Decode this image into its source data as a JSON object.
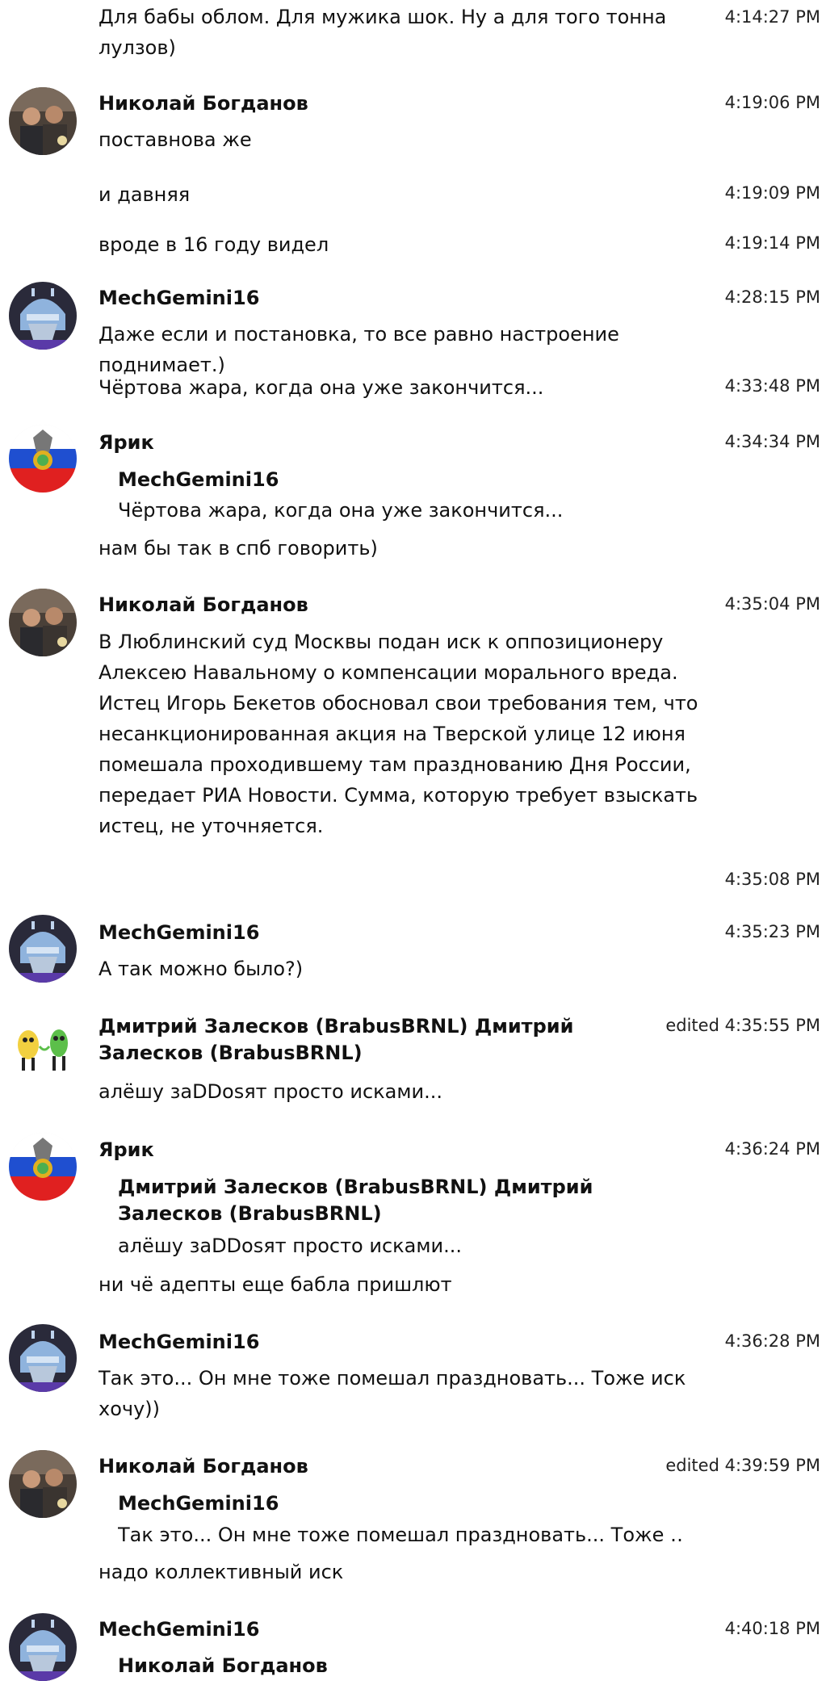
{
  "messages": {
    "m0": {
      "text": "Для бабы облом. Для мужика шок. Ну а для того тонна лулзов)",
      "time": "4:14:27 PM"
    },
    "g1": {
      "author": "Николай Богданов",
      "time": "4:19:06 PM",
      "text": "поставнова же"
    },
    "m2": {
      "text": "и давняя",
      "time": "4:19:09 PM"
    },
    "m3": {
      "text": "вроде в 16 году видел",
      "time": "4:19:14 PM"
    },
    "g4": {
      "author": "MechGemini16",
      "time": "4:28:15 PM",
      "text": "Даже если и постановка, то все равно настроение поднимает.)"
    },
    "m5": {
      "text": "Чёртова жара, когда она уже закончится...",
      "time": "4:33:48 PM"
    },
    "g6": {
      "author": "Ярик",
      "time": "4:34:34 PM",
      "quote_author": "MechGemini16",
      "quote_text": "Чёртова жара, когда она уже закончится...",
      "text": "нам бы так в спб говорить)"
    },
    "g7": {
      "author": "Николай Богданов",
      "time": "4:35:04 PM",
      "text": "В Люблинский суд Москвы подан иск к оппозиционеру Алексею Навальному о компенсации морального вреда. Истец Игорь Бекетов обосновал свои требования тем, что несанкционированная акция на Тверской улице 12 июня помешала проходившему там празднованию Дня России, передает РИА Новости. Сумма, которую требует взыскать истец, не уточняется."
    },
    "m8": {
      "time": "4:35:08 PM"
    },
    "g9": {
      "author": "MechGemini16",
      "time": "4:35:23 PM",
      "text": "А так можно было?)"
    },
    "g10": {
      "author": "Дмитрий Залесков (BrabusBRNL) Дмитрий Залесков (BrabusBRNL)",
      "time": "edited 4:35:55 PM",
      "text": "алёшу заDDosят просто исками..."
    },
    "g11": {
      "author": "Ярик",
      "time": "4:36:24 PM",
      "quote_author": "Дмитрий Залесков (BrabusBRNL) Дмитрий Залесков (BrabusBRNL)",
      "quote_text": "алёшу заDDosят просто исками...",
      "text": "ни чё адепты еще бабла пришлют"
    },
    "g12": {
      "author": "MechGemini16",
      "time": "4:36:28 PM",
      "text": "Так это... Он мне тоже помешал праздновать... Тоже иск хочу))"
    },
    "g13": {
      "author": "Николай Богданов",
      "time": "edited 4:39:59 PM",
      "quote_author": "MechGemini16",
      "quote_text": "Так это... Он мне тоже помешал праздновать... Тоже …",
      "text": "надо коллективный иск"
    },
    "g14": {
      "author": "MechGemini16",
      "time": "4:40:18 PM",
      "quote_author": "Николай Богданов"
    }
  },
  "avatars": {
    "nikolay": "photo-avatar",
    "mech": "shredder-helmet-avatar",
    "yarik": "russian-flag-emblem-avatar",
    "dmitry": "cartoon-characters-avatar"
  },
  "colors": {
    "background": "#ffffff",
    "text": "#111111",
    "helmet": "#8fb3dd",
    "flag_blue": "#1f4fd0",
    "flag_red": "#e02020"
  }
}
